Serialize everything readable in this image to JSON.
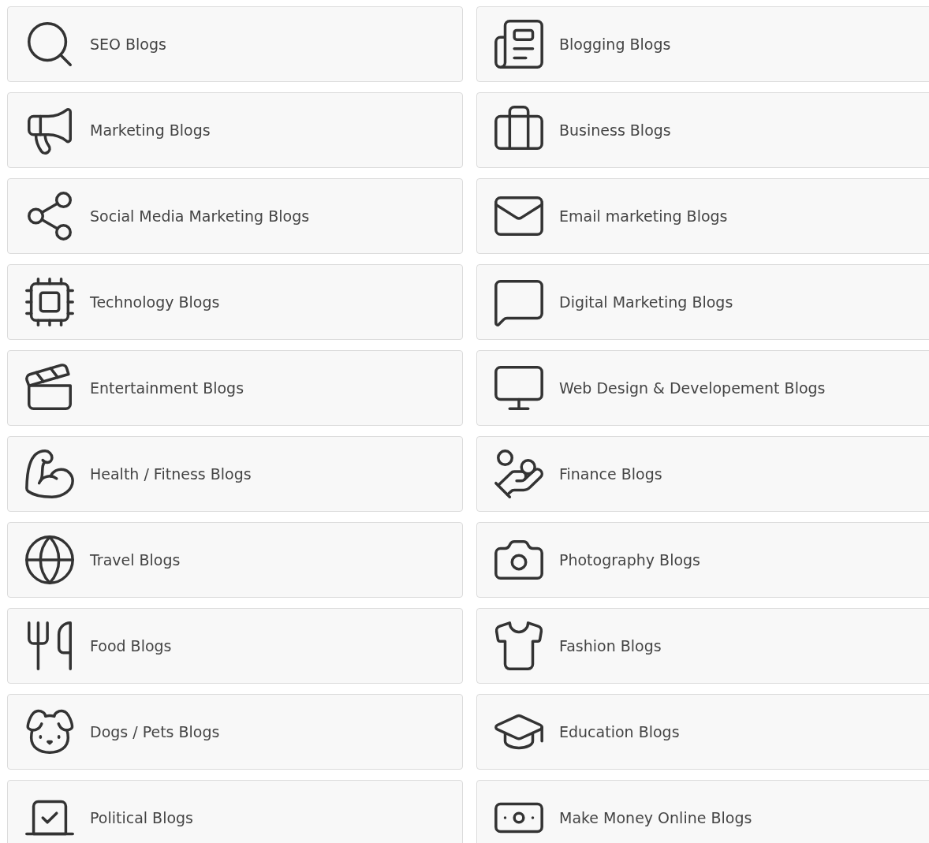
{
  "categories": [
    {
      "label": "SEO Blogs",
      "kind": "seo"
    },
    {
      "label": "Blogging Blogs",
      "kind": "blogging"
    },
    {
      "label": "Marketing Blogs",
      "kind": "marketing"
    },
    {
      "label": "Business Blogs",
      "kind": "business"
    },
    {
      "label": "Social Media Marketing Blogs",
      "kind": "social"
    },
    {
      "label": "Email marketing Blogs",
      "kind": "email"
    },
    {
      "label": "Technology Blogs",
      "kind": "technology"
    },
    {
      "label": "Digital Marketing Blogs",
      "kind": "digital"
    },
    {
      "label": "Entertainment Blogs",
      "kind": "entertainment"
    },
    {
      "label": "Web Design & Developement Blogs",
      "kind": "web"
    },
    {
      "label": "Health / Fitness Blogs",
      "kind": "health"
    },
    {
      "label": "Finance Blogs",
      "kind": "finance"
    },
    {
      "label": "Travel Blogs",
      "kind": "travel"
    },
    {
      "label": "Photography Blogs",
      "kind": "photography"
    },
    {
      "label": "Food Blogs",
      "kind": "food"
    },
    {
      "label": "Fashion Blogs",
      "kind": "fashion"
    },
    {
      "label": "Dogs / Pets Blogs",
      "kind": "pets"
    },
    {
      "label": "Education Blogs",
      "kind": "education"
    },
    {
      "label": "Political Blogs",
      "kind": "political"
    },
    {
      "label": "Make Money Online Blogs",
      "kind": "money"
    }
  ]
}
